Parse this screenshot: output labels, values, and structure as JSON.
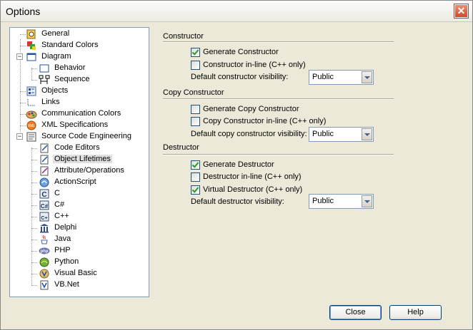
{
  "window": {
    "title": "Options",
    "close_glyph": "✕"
  },
  "tree": [
    {
      "label": "General",
      "icon": "general-icon"
    },
    {
      "label": "Standard Colors",
      "icon": "colors-icon"
    },
    {
      "label": "Diagram",
      "icon": "diagram-icon",
      "expanded": true
    },
    {
      "label": "Behavior",
      "icon": "behavior-icon"
    },
    {
      "label": "Sequence",
      "icon": "sequence-icon"
    },
    {
      "label": "Objects",
      "icon": "objects-icon"
    },
    {
      "label": "Links",
      "icon": "links-icon"
    },
    {
      "label": "Communication Colors",
      "icon": "communication-colors-icon"
    },
    {
      "label": "XML Specifications",
      "icon": "xml-icon"
    },
    {
      "label": "Source Code Engineering",
      "icon": "source-code-icon",
      "expanded": true
    },
    {
      "label": "Code Editors",
      "icon": "code-editors-icon"
    },
    {
      "label": "Object Lifetimes",
      "icon": "object-lifetimes-icon",
      "selected": true
    },
    {
      "label": "Attribute/Operations",
      "icon": "attribute-operations-icon"
    },
    {
      "label": "ActionScript",
      "icon": "actionscript-icon"
    },
    {
      "label": "C",
      "icon": "c-icon"
    },
    {
      "label": "C#",
      "icon": "csharp-icon"
    },
    {
      "label": "C++",
      "icon": "cpp-icon"
    },
    {
      "label": "Delphi",
      "icon": "delphi-icon"
    },
    {
      "label": "Java",
      "icon": "java-icon"
    },
    {
      "label": "PHP",
      "icon": "php-icon"
    },
    {
      "label": "Python",
      "icon": "python-icon"
    },
    {
      "label": "Visual Basic",
      "icon": "visual-basic-icon"
    },
    {
      "label": "VB.Net",
      "icon": "vbnet-icon"
    }
  ],
  "constructor": {
    "title": "Constructor",
    "generate": {
      "label": "Generate Constructor",
      "checked": true
    },
    "inline": {
      "label": "Constructor in-line (C++ only)",
      "checked": false
    },
    "visibility_label": "Default constructor visibility:",
    "visibility_value": "Public"
  },
  "copy_constructor": {
    "title": "Copy Constructor",
    "generate": {
      "label": "Generate Copy Constructor",
      "checked": false
    },
    "inline": {
      "label": "Copy Constructor in-line (C++ only)",
      "checked": false
    },
    "visibility_label": "Default copy constructor visibility:",
    "visibility_value": "Public"
  },
  "destructor": {
    "title": "Destructor",
    "generate": {
      "label": "Generate Destructor",
      "checked": true
    },
    "inline": {
      "label": "Destructor in-line (C++ only)",
      "checked": false
    },
    "virtual": {
      "label": "Virtual Destructor (C++ only)",
      "checked": true
    },
    "visibility_label": "Default destructor visibility:",
    "visibility_value": "Public"
  },
  "buttons": {
    "close": "Close",
    "help": "Help"
  }
}
